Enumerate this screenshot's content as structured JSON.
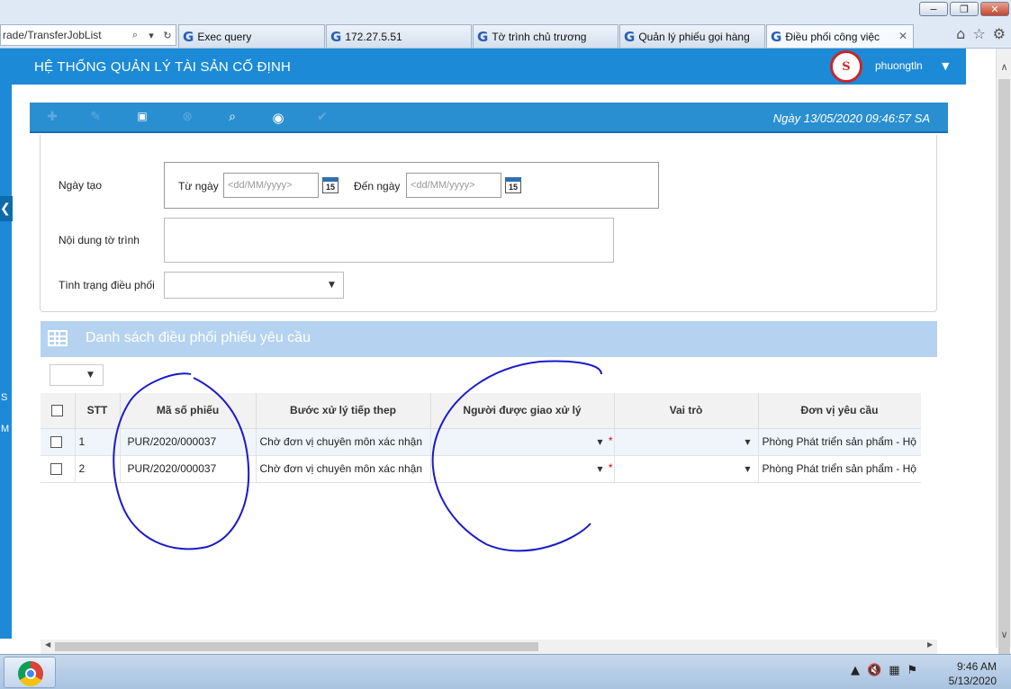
{
  "browser": {
    "address": "rade/TransferJobList",
    "tabs": [
      {
        "label": "Exec query"
      },
      {
        "label": "172.27.5.51"
      },
      {
        "label": "Tờ trình chủ trương"
      },
      {
        "label": "Quản lý phiếu gọi hàng"
      },
      {
        "label": "Điều phối công việc"
      }
    ],
    "tab_icon_glyph": "G"
  },
  "app": {
    "title": "HỆ THỐNG QUẢN LÝ TÀI SẢN CỐ ĐỊNH",
    "username": "phuongtln",
    "brand_color": "#1c8ad6"
  },
  "sidebar": {
    "text1": "S",
    "text2": "M"
  },
  "toolbar": {
    "datetime": "Ngày 13/05/2020  09:46:57 SA",
    "icons": [
      "add-icon",
      "edit-icon",
      "save-icon",
      "delete-icon",
      "search-icon",
      "view-icon",
      "approve-icon"
    ]
  },
  "filter": {
    "created_label": "Ngày tạo",
    "from_label": "Từ ngày",
    "to_label": "Đến ngày",
    "from_placeholder": "<dd/MM/yyyy>",
    "to_placeholder": "<dd/MM/yyyy>",
    "calendar_day": "15",
    "content_label": "Nội dung tờ trình",
    "status_label": "Tình trạng điều phối"
  },
  "list": {
    "title": "Danh sách điều phối phiếu yêu cầu",
    "columns": [
      "STT",
      "Mã số phiếu",
      "Bước xử lý tiếp thep",
      "Người được giao xử lý",
      "Vai trò",
      "Đơn vị yêu cầu"
    ],
    "rows": [
      {
        "stt": "1",
        "code": "PUR/2020/000037",
        "step": "Chờ đơn vị chuyên môn xác nhận",
        "assignee": "",
        "role": "",
        "unit": "Phòng Phát triển sản phẩm - Hộ"
      },
      {
        "stt": "2",
        "code": "PUR/2020/000037",
        "step": "Chờ đơn vị chuyên môn xác nhận",
        "assignee": "",
        "role": "",
        "unit": "Phòng Phát triển sản phẩm - Hộ"
      }
    ],
    "required_mark": "*"
  },
  "taskbar": {
    "time": "9:46 AM",
    "date": "5/13/2020"
  }
}
